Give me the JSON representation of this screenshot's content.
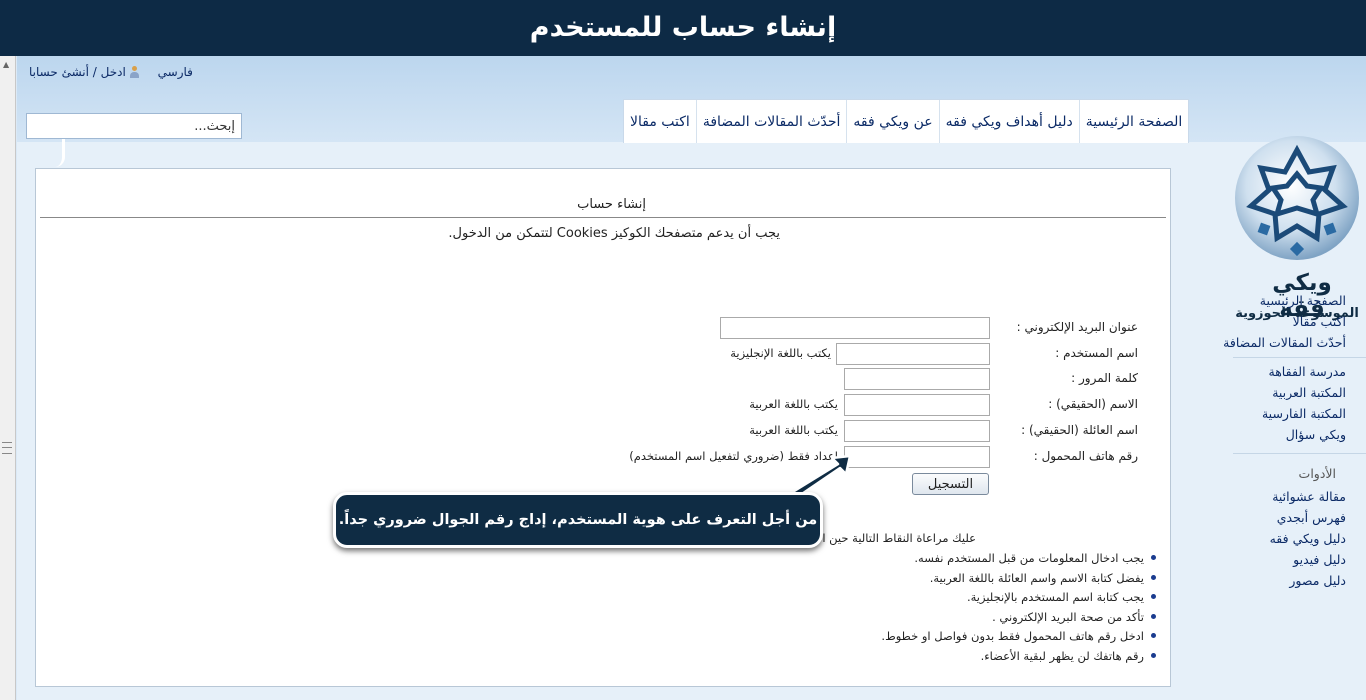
{
  "banner": {
    "title": "إنشاء حساب للمستخدم"
  },
  "personal": {
    "language": "فارسي",
    "login": "ادخل / أنشئ حسابا"
  },
  "search": {
    "placeholder": "إبحث..."
  },
  "tabs": [
    {
      "label": "الصفحة الرئيسية"
    },
    {
      "label": "دليل أهداف ويكي فقه"
    },
    {
      "label": "عن ويكي فقه"
    },
    {
      "label": "أحدّث المقالات المضافة"
    },
    {
      "label": "اكتب مقالا"
    }
  ],
  "form": {
    "title": "إنشاء حساب",
    "cookie_note": "يجب أن يدعم متصفحك الكوكيز Cookies لتتمكن من الدخول.",
    "fields": [
      {
        "label": "عنوان البريد الإلكتروني :",
        "hint": ""
      },
      {
        "label": "اسم المستخدم :",
        "hint": "يكتب باللغة الإنجليزية"
      },
      {
        "label": "كلمة المرور :",
        "hint": ""
      },
      {
        "label": "الاسم (الحقيقي) :",
        "hint": "يكتب باللغة العربية"
      },
      {
        "label": "اسم العائلة (الحقيقي) :",
        "hint": "يكتب باللغة العربية"
      },
      {
        "label": "رقم هاتف المحمول :",
        "hint": "اعداد فقط (ضروري لتفعيل اسم المستخدم)"
      }
    ],
    "submit_label": "التسجيل",
    "notes_title": "عليك مراعاة النقاط التالية حين التسجيل:",
    "notes": [
      "يجب ادخال المعلومات من قبل المستخدم نفسه.",
      "يفضل كتابة الاسم واسم العائلة باللغة العربية.",
      "يجب كتابة اسم المستخدم بالإنجليزية.",
      "تأكد من صحة البريد الإلكتروني .",
      "ادخل رقم هاتف المحمول فقط بدون فواصل او خطوط.",
      "رقم هاتفك لن يظهر لبقية الأعضاء."
    ]
  },
  "callout": {
    "text": "من أجل التعرف على هوية المستخدم، إداج رقم الجوال ضروري جداً."
  },
  "sidebar": {
    "logo_title": "ويكي فقه",
    "logo_subtitle": "الموسوعة الحوزوية",
    "nav1": [
      "الصفحة الرئيسية",
      "اكتب مقالا",
      "أحدّث المقالات المضافة"
    ],
    "nav2": [
      "مدرسة الفقاهة",
      "المكتبة العربية",
      "المكتبة الفارسية",
      "ويكي سؤال"
    ],
    "tools_heading": "الأدوات",
    "tools": [
      "مقالة عشوائية",
      "فهرس أبجدي",
      "دليل ويكي فقه",
      "دليل فيديو",
      "دليل مصور"
    ]
  }
}
